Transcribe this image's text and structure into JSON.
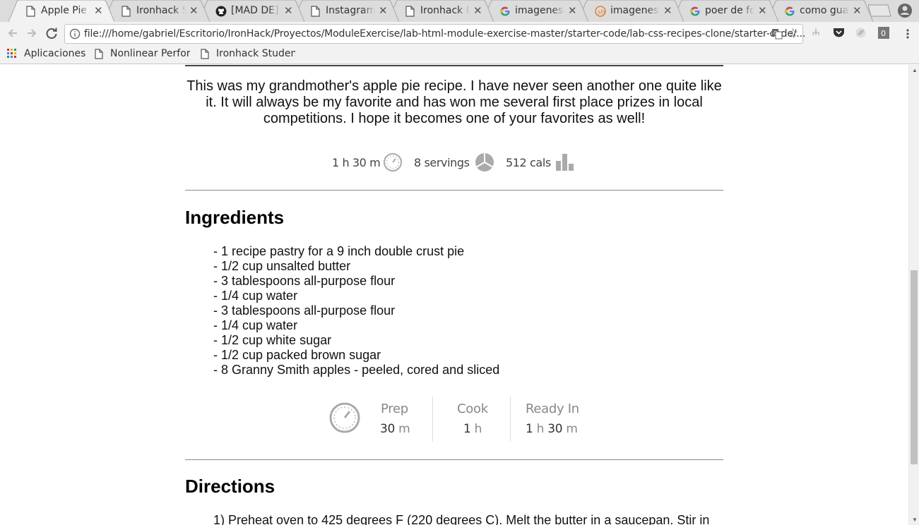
{
  "browser": {
    "tabs": [
      {
        "title": "Apple Pie R",
        "icon": "page-icon",
        "active": true
      },
      {
        "title": "Ironhack St",
        "icon": "page-icon",
        "active": false
      },
      {
        "title": "[MAD DE] ",
        "icon": "github-icon",
        "active": false
      },
      {
        "title": "Instagram",
        "icon": "page-icon",
        "active": false
      },
      {
        "title": "Ironhack D",
        "icon": "page-icon",
        "active": false
      },
      {
        "title": "imagenes ",
        "icon": "google-icon",
        "active": false
      },
      {
        "title": "imagenes ",
        "icon": "scribd-icon",
        "active": false
      },
      {
        "title": "poer de fon",
        "icon": "google-icon",
        "active": false
      },
      {
        "title": "como guar",
        "icon": "google-icon",
        "active": false
      }
    ],
    "url": "file:///home/gabriel/Escritorio/IronHack/Proyectos/ModuleExercise/lab-html-module-exercise-master/starter-code/lab-css-recipes-clone/starter-code/...",
    "bookmarks": [
      {
        "label": "Aplicaciones",
        "icon": "apps-grid-icon"
      },
      {
        "label": "Nonlinear Perfor",
        "icon": "page-icon"
      },
      {
        "label": "Ironhack Studen",
        "icon": "page-icon"
      }
    ]
  },
  "recipe": {
    "intro": "This was my grandmother's apple pie recipe. I have never seen another one quite like it. It will always be my favorite and has won me several first place prizes in local competitions. I hope it becomes one of your favorites as well!",
    "stats": {
      "time": "1 h 30 m",
      "servings": "8 servings",
      "calories": "512 cals"
    },
    "ingredients_title": "Ingredients",
    "ingredients": [
      "- 1 recipe pastry for a 9 inch double crust pie",
      "- 1/2 cup unsalted butter",
      "- 3 tablespoons all-purpose flour",
      "- 1/4 cup water",
      "- 3 tablespoons all-purpose flour",
      "- 1/4 cup water",
      "- 1/2 cup white sugar",
      "- 1/2 cup packed brown sugar",
      "- 8 Granny Smith apples - peeled, cored and sliced"
    ],
    "times": {
      "prep_label": "Prep",
      "prep_num": "30",
      "prep_unit": "m",
      "cook_label": "Cook",
      "cook_num": "1",
      "cook_unit": "h",
      "ready_label": "Ready In",
      "ready_h": "1",
      "ready_h_unit": "h",
      "ready_m": "30",
      "ready_m_unit": "m"
    },
    "directions_title": "Directions",
    "directions": [
      "1) Preheat oven to 425 degrees F (220 degrees C). Melt the butter in a saucepan. Stir in"
    ]
  },
  "colors": {
    "tabstrip": "#dcdcdc",
    "toolbar": "#f2f2f2",
    "divider": "#888888",
    "muted_text": "#888888"
  }
}
